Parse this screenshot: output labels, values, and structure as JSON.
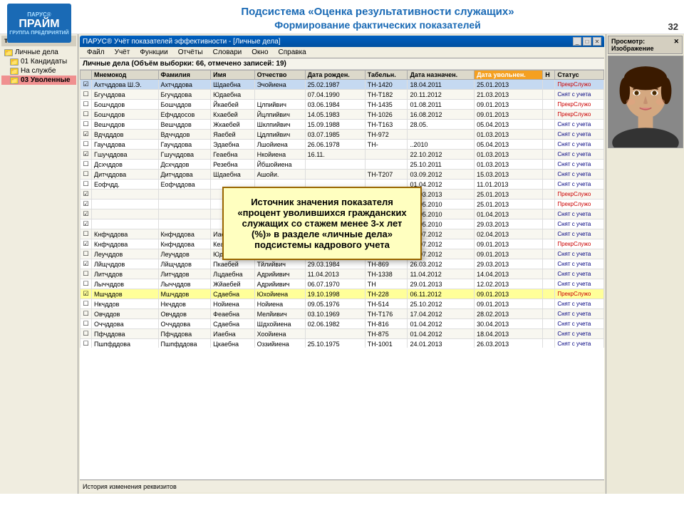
{
  "header": {
    "title1": "Подсистема «Оценка результативности служащих»",
    "title2": "Формирование фактических показателей",
    "logo_name": "ПРАЙМ",
    "logo_top": "ПАРУС®",
    "logo_sub": "ГРУППА ПРЕДПРИЯТИЙ",
    "page_number": "32"
  },
  "window": {
    "title": "ПАРУС® Учёт показателей эффективности - [Личные дела]",
    "menubar": [
      "Файл",
      "Учёт",
      "Функции",
      "Отчёты",
      "Словари",
      "Окно",
      "Справка"
    ]
  },
  "sidebar": {
    "title": "талоги",
    "items": [
      {
        "label": "Личные дела",
        "type": "folder",
        "selected": false
      },
      {
        "label": "01 Кандидаты",
        "type": "folder",
        "selected": false
      },
      {
        "label": "На службе",
        "type": "folder",
        "selected": false
      },
      {
        "label": "03 Уволенные",
        "type": "folder",
        "selected": true,
        "highlighted": true
      }
    ]
  },
  "table": {
    "caption": "Личные дела (Объём выборки: 66, отмечено записей: 19)",
    "columns": [
      "",
      "Мнемокод",
      "Фамилия",
      "Имя",
      "Отчество",
      "Дата рожден.",
      "Табельн.",
      "Дата назначен.",
      "Дата увольнен.",
      "Н",
      "Статус"
    ],
    "rows": [
      {
        "checked": true,
        "selected": true,
        "mnemokod": "Ахтчддова Ш.Э.",
        "familiya": "Ахтчддова",
        "imya": "Шдаебна",
        "otchestvo": "Эчойиена",
        "date_born": "25.02.1987",
        "tabelny": "ТН-1420",
        "date_nazn": "18.04.2011",
        "date_uvol": "25.01.2013",
        "n": "",
        "status": "ПрекрСлужо",
        "status_class": "status-prekr"
      },
      {
        "checked": false,
        "mnemokod": "Бгучддова",
        "familiya": "Бгучддова",
        "imya": "Юдаебна",
        "otchestvo": "",
        "date_born": "07.04.1990",
        "tabelny": "ТН-T182",
        "date_nazn": "20.11.2012",
        "date_uvol": "21.03.2013",
        "n": "",
        "status": "Снят с учета",
        "status_class": "status-snat"
      },
      {
        "checked": false,
        "mnemokod": "Бошчддов",
        "familiya": "Бошчддов",
        "imya": "Йкаебей",
        "otchestvo": "Цлпийвич",
        "date_born": "03.06.1984",
        "tabelny": "ТН-1435",
        "date_nazn": "01.08.2011",
        "date_uvol": "09.01.2013",
        "n": "",
        "status": "ПрекрСлужо",
        "status_class": "status-prekr"
      },
      {
        "checked": false,
        "mnemokod": "Бошчддов",
        "familiya": "Ефчддосов",
        "imya": "Кхаебей",
        "otchestvo": "Йцлпийвич",
        "date_born": "14.05.1983",
        "tabelny": "ТН-1026",
        "date_nazn": "16.08.2012",
        "date_uvol": "09.01.2013",
        "n": "",
        "status": "ПрекрСлужо",
        "status_class": "status-prekr"
      },
      {
        "checked": false,
        "mnemokod": "Вешчддов",
        "familiya": "Вешчддов",
        "imya": "Жкаебей",
        "otchestvo": "Шклпийвич",
        "date_born": "15.09.1988",
        "tabelny": "ТН-T163",
        "date_nazn": "28.05.",
        "date_uvol": "05.04.2013",
        "n": "",
        "status": "Снят с учета",
        "status_class": "status-snat"
      },
      {
        "checked": true,
        "mnemokod": "Вдчдддов",
        "familiya": "Вдччддов",
        "imya": "Яаебей",
        "otchestvo": "Цдлпийвич",
        "date_born": "03.07.1985",
        "tabelny": "ТН-972",
        "date_nazn": "",
        "date_uvol": "01.03.2013",
        "n": "",
        "status": "Снят с учета",
        "status_class": "status-snat"
      },
      {
        "checked": false,
        "mnemokod": "Гаучддова",
        "familiya": "Гаучддова",
        "imya": "Эдаебна",
        "otchestvo": "Лшойиена",
        "date_born": "26.06.1978",
        "tabelny": "ТН-",
        "date_nazn": "..2010",
        "date_uvol": "05.04.2013",
        "n": "",
        "status": "Снят с учета",
        "status_class": "status-snat"
      },
      {
        "checked": true,
        "mnemokod": "Гшучддова",
        "familiya": "Гшучддова",
        "imya": "Геаебна",
        "otchestvo": "Нкойиена",
        "date_born": "16.11.",
        "tabelny": "",
        "date_nazn": "22.10.2012",
        "date_uvol": "01.03.2013",
        "n": "",
        "status": "Снят с учета",
        "status_class": "status-snat"
      },
      {
        "checked": false,
        "mnemokod": "Дсхчддов",
        "familiya": "Дсхчддов",
        "imya": "Резебна",
        "otchestvo": "Йбшойиена",
        "date_born": "",
        "tabelny": "",
        "date_nazn": "25.10.2011",
        "date_uvol": "01.03.2013",
        "n": "",
        "status": "Снят с учета",
        "status_class": "status-snat"
      },
      {
        "checked": false,
        "mnemokod": "Дитчддова",
        "familiya": "Дитчддова",
        "imya": "Шдаебна",
        "otchestvo": "Ашойи.",
        "date_born": "",
        "tabelny": "ТН-T207",
        "date_nazn": "03.09.2012",
        "date_uvol": "15.03.2013",
        "n": "",
        "status": "Снят с учета",
        "status_class": "status-snat"
      },
      {
        "checked": false,
        "mnemokod": "Еофчдд.",
        "familiya": "Еофчддова",
        "imya": "",
        "otchestvo": "",
        "date_born": "",
        "tabelny": "",
        "date_nazn": "01.04.2012",
        "date_uvol": "11.01.2013",
        "n": "",
        "status": "Снят с учета",
        "status_class": "status-snat"
      },
      {
        "checked": true,
        "mnemokod": "",
        "familiya": "",
        "imya": "",
        "otchestvo": "",
        "date_born": "",
        "tabelny": "",
        "date_nazn": "15.03.2013",
        "date_uvol": "25.01.2013",
        "n": "",
        "status": "ПрекрСлужо",
        "status_class": "status-prekr"
      },
      {
        "checked": true,
        "mnemokod": "",
        "familiya": "",
        "imya": "",
        "otchestvo": "",
        "date_born": "",
        "tabelny": "",
        "date_nazn": "14.05.2010",
        "date_uvol": "25.01.2013",
        "n": "",
        "status": "ПрекрСлужо",
        "status_class": "status-prekr"
      },
      {
        "checked": true,
        "mnemokod": "",
        "familiya": "",
        "imya": "",
        "otchestvo": "",
        "date_born": "",
        "tabelny": "",
        "date_nazn": "01.05.2010",
        "date_uvol": "01.04.2013",
        "n": "",
        "status": "Снят с учета",
        "status_class": "status-snat"
      },
      {
        "checked": true,
        "mnemokod": "",
        "familiya": "",
        "imya": "",
        "otchestvo": "",
        "date_born": "",
        "tabelny": "",
        "date_nazn": "01.05.2010",
        "date_uvol": "29.03.2013",
        "n": "",
        "status": "Снят с учета",
        "status_class": "status-snat"
      },
      {
        "checked": false,
        "mnemokod": "Кнфчддова",
        "familiya": "Кнфчддова",
        "imya": "Иаебна",
        "otchestvo": "Нойиена",
        "date_born": "22.09.1971",
        "tabelny": "ТН-867",
        "date_nazn": "01.07.2012",
        "date_uvol": "02.04.2013",
        "n": "",
        "status": "Снят с учета",
        "status_class": "status-snat"
      },
      {
        "checked": true,
        "mnemokod": "Кнфчддова",
        "familiya": "Кнфчддова",
        "imya": "Кеабна",
        "otchestvo": "Раойиена",
        "date_born": "28.10.1987",
        "tabelny": "ТН-1439",
        "date_nazn": "19.07.2012",
        "date_uvol": "09.01.2013",
        "n": "",
        "status": "ПрекрСлужо",
        "status_class": "status-prekr"
      },
      {
        "checked": false,
        "mnemokod": "Леучддов",
        "familiya": "Леучддов",
        "imya": "Юдаебна",
        "otchestvo": "",
        "date_born": "24.08.1986",
        "tabelny": "ТН-1060",
        "date_nazn": "18.07.2012",
        "date_uvol": "09.01.2013",
        "n": "",
        "status": "Снят с учета",
        "status_class": "status-snat"
      },
      {
        "checked": true,
        "mnemokod": "Лйщчддов",
        "familiya": "Лйщчддов",
        "imya": "Пкаебей",
        "otchestvo": "Тйлийвич",
        "date_born": "29.03.1984",
        "tabelny": "ТН-869",
        "date_nazn": "26.03.2012",
        "date_uvol": "29.03.2013",
        "n": "",
        "status": "Снят с учета",
        "status_class": "status-snat"
      },
      {
        "checked": false,
        "mnemokod": "Литчддов",
        "familiya": "Литчддов",
        "imya": "Лцдаебна",
        "otchestvo": "Адрийивич",
        "date_born": "11.04.2013",
        "tabelny": "ТН-1338",
        "date_nazn": "11.04.2012",
        "date_uvol": "14.04.2013",
        "n": "",
        "status": "Снят с учета",
        "status_class": "status-snat"
      },
      {
        "checked": false,
        "mnemokod": "Лыччддов",
        "familiya": "Лыччддов",
        "imya": "Жйаебей",
        "otchestvo": "Адрийивич",
        "date_born": "06.07.1970",
        "tabelny": "ТН",
        "date_nazn": "29.01.2013",
        "date_uvol": "12.02.2013",
        "n": "",
        "status": "Снят с учета",
        "status_class": "status-snat"
      },
      {
        "checked": true,
        "mnemokod": "Мшчддов",
        "familiya": "Мшчддов",
        "imya": "Сдаебна",
        "otchestvo": "Юхойиена",
        "date_born": "19.10.1998",
        "tabelny": "ТН-228",
        "date_nazn": "06.11.2012",
        "date_uvol": "09.01.2013",
        "n": "",
        "status": "ПрекрСлужо",
        "status_class": "status-prekr",
        "row_class": "status-yellow"
      },
      {
        "checked": false,
        "mnemokod": "Нкчддов",
        "familiya": "Нкчддов",
        "imya": "Нойиена",
        "otchestvo": "Нойиена",
        "date_born": "09.05.1976",
        "tabelny": "ТН-514",
        "date_nazn": "25.10.2012",
        "date_uvol": "09.01.2013",
        "n": "",
        "status": "Снят с учета",
        "status_class": "status-snat"
      },
      {
        "checked": false,
        "mnemokod": "Овчддов",
        "familiya": "Овчддов",
        "imya": "Феаебна",
        "otchestvo": "Мелйивич",
        "date_born": "03.10.1969",
        "tabelny": "ТН-T176",
        "date_nazn": "17.04.2012",
        "date_uvol": "28.02.2013",
        "n": "",
        "status": "Снят с учета",
        "status_class": "status-snat"
      },
      {
        "checked": false,
        "mnemokod": "Оччддова",
        "familiya": "Оччддова",
        "imya": "Сдаебна",
        "otchestvo": "Шдхойиена",
        "date_born": "02.06.1982",
        "tabelny": "ТН-816",
        "date_nazn": "01.04.2012",
        "date_uvol": "30.04.2013",
        "n": "",
        "status": "Снят с учета",
        "status_class": "status-snat"
      },
      {
        "checked": false,
        "mnemokod": "Пфчддова",
        "familiya": "Пфчддова",
        "imya": "Иаебна",
        "otchestvo": "Хоойиена",
        "date_born": "",
        "tabelny": "ТН-875",
        "date_nazn": "01.04.2012",
        "date_uvol": "18.04.2013",
        "n": "",
        "status": "Снят с учета",
        "status_class": "status-snat"
      },
      {
        "checked": false,
        "mnemokod": "Пшпфддова",
        "familiya": "Пшпфддова",
        "imya": "Цкаебна",
        "otchestvo": "Оззийиена",
        "date_born": "25.10.1975",
        "tabelny": "ТН-1001",
        "date_nazn": "24.01.2013",
        "date_uvol": "26.03.2013",
        "n": "",
        "status": "Снят с учета",
        "status_class": "status-snat"
      }
    ]
  },
  "tooltip": {
    "text": "Источник значения показателя «процент уволившихся гражданских служащих со стажем менее 3-х лет (%)» в разделе «личные дела» подсистемы кадрового учета"
  },
  "bottom": {
    "history_label": "История изменения реквизитов"
  },
  "preview": {
    "title": "Просмотр: Изображение"
  }
}
